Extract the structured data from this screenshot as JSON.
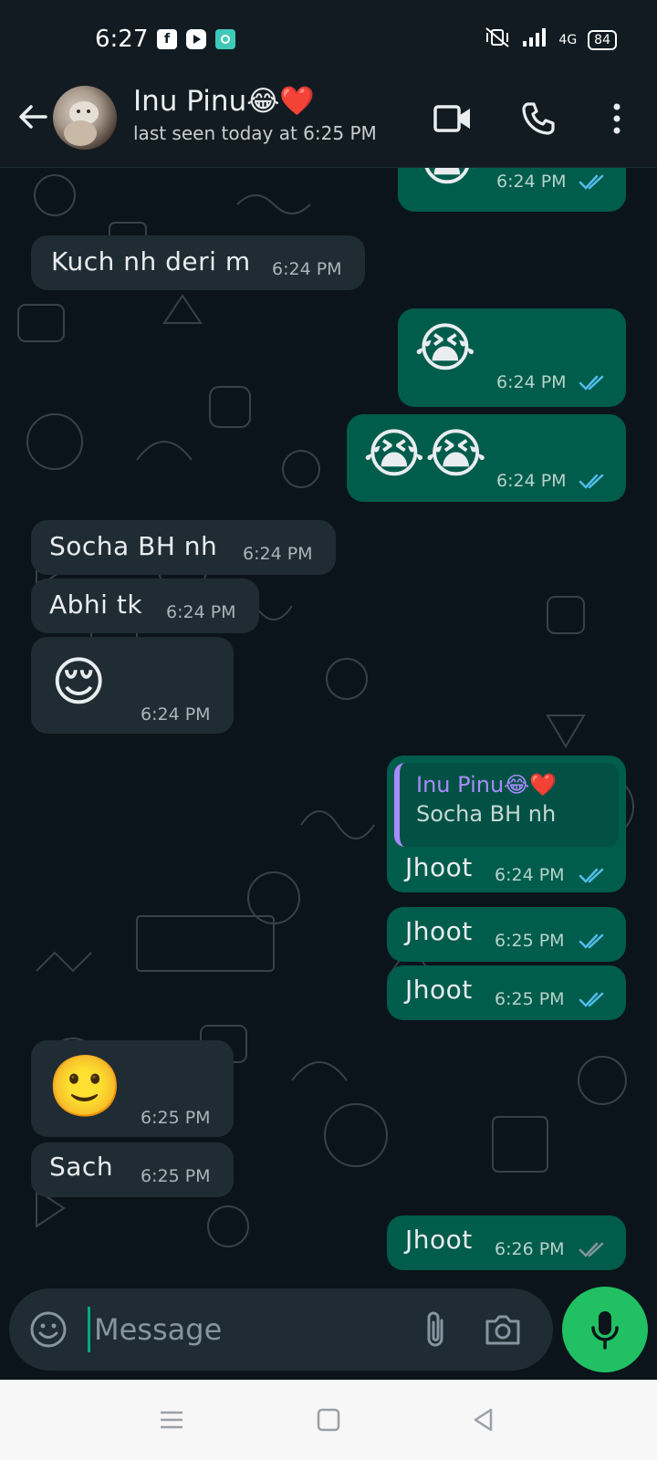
{
  "status_bar": {
    "time": "6:27",
    "network": "4G",
    "battery": "84",
    "app_icons": [
      "facebook-icon",
      "youtube-icon",
      "app-icon"
    ]
  },
  "header": {
    "contact_name": "Inu Pinu😂❤️",
    "last_seen": "last seen today at 6:25 PM"
  },
  "messages": [
    {
      "dir": "out",
      "emoji": "😭",
      "time": "6:24 PM",
      "ticks": "read"
    },
    {
      "dir": "in",
      "text": "Kuch nh deri m",
      "time": "6:24 PM"
    },
    {
      "dir": "out",
      "emoji": "😭",
      "time": "6:24 PM",
      "ticks": "read"
    },
    {
      "dir": "out",
      "emoji": "😭😭",
      "time": "6:24 PM",
      "ticks": "read"
    },
    {
      "dir": "in",
      "text": "Socha BH nh",
      "time": "6:24 PM"
    },
    {
      "dir": "in",
      "text": "Abhi tk",
      "time": "6:24 PM"
    },
    {
      "dir": "in",
      "emoji": "😌",
      "time": "6:24 PM"
    },
    {
      "dir": "out",
      "text": "Jhoot",
      "time": "6:24 PM",
      "ticks": "read",
      "reply": {
        "name": "Inu Pinu😂❤️",
        "text": "Socha BH nh"
      }
    },
    {
      "dir": "out",
      "text": "Jhoot",
      "time": "6:25 PM",
      "ticks": "read"
    },
    {
      "dir": "out",
      "text": "Jhoot",
      "time": "6:25 PM",
      "ticks": "read"
    },
    {
      "dir": "in",
      "emoji": "🙂",
      "time": "6:25 PM"
    },
    {
      "dir": "in",
      "text": "Sach",
      "time": "6:25 PM"
    },
    {
      "dir": "out",
      "text": "Jhoot",
      "time": "6:26 PM",
      "ticks": "delivered"
    }
  ],
  "composer": {
    "placeholder": "Message"
  },
  "colors": {
    "incoming_bubble": "#202c33",
    "outgoing_bubble": "#005c4b",
    "read_tick": "#53bdeb",
    "delivered_tick": "#8696a0",
    "accent": "#21c063"
  }
}
